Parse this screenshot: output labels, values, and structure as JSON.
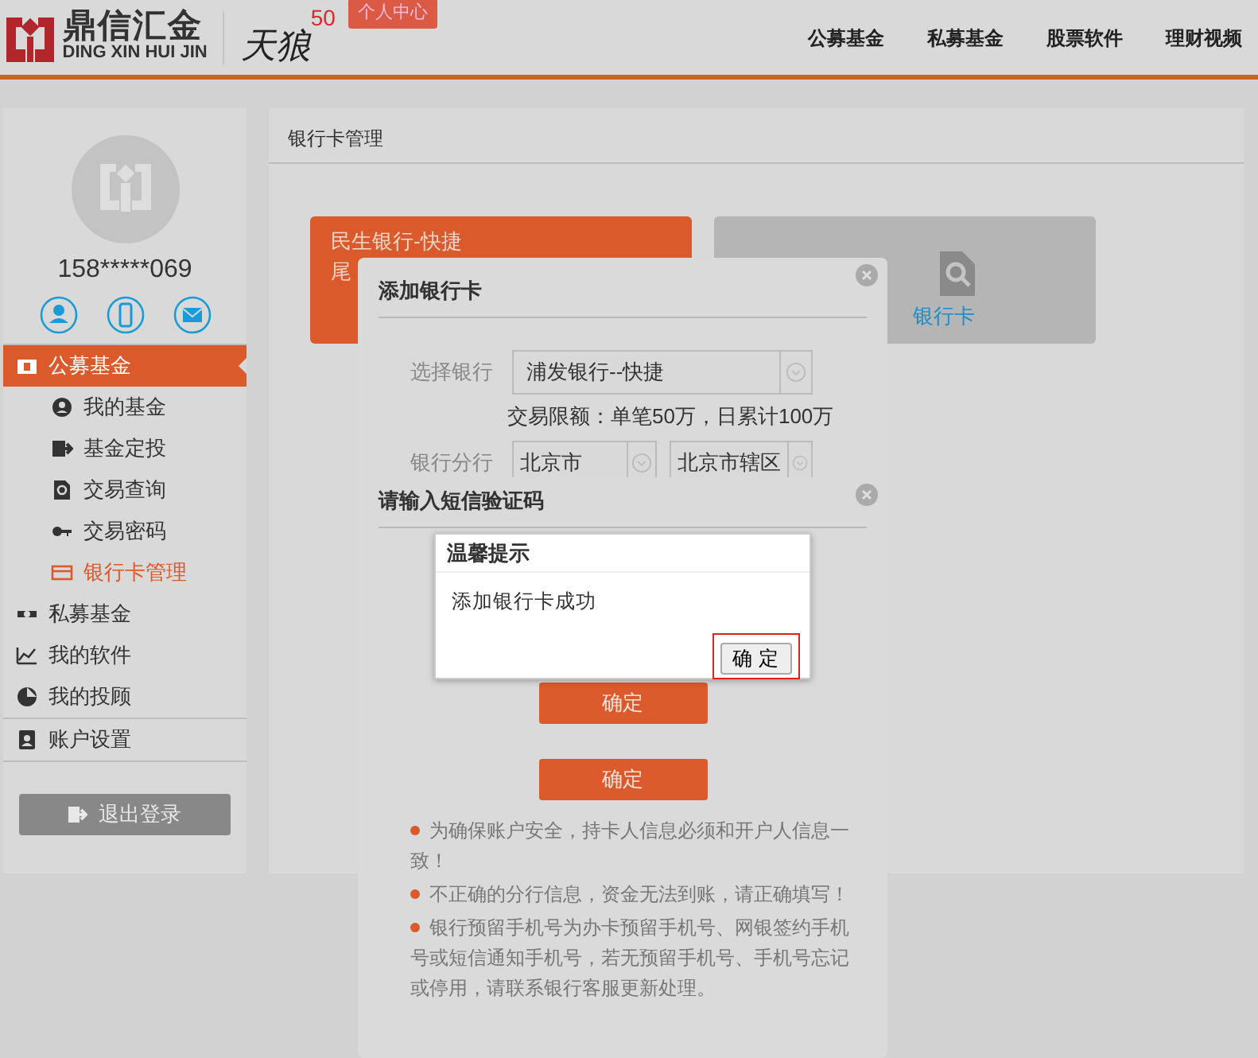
{
  "header": {
    "logo_title": "鼎信汇金",
    "logo_subtitle": "DING XIN HUI JIN",
    "brand_mark": "天狼",
    "brand_number": "50",
    "user_center": "个人中心",
    "nav": [
      {
        "label": "公募基金"
      },
      {
        "label": "私募基金"
      },
      {
        "label": "股票软件"
      },
      {
        "label": "理财视频"
      }
    ]
  },
  "sidebar": {
    "phone": "158*****069",
    "menu": [
      {
        "label": "公募基金",
        "selected": true,
        "children": [
          {
            "label": "我的基金",
            "selected": false
          },
          {
            "label": "基金定投",
            "selected": false
          },
          {
            "label": "交易查询",
            "selected": false
          },
          {
            "label": "交易密码",
            "selected": false
          },
          {
            "label": "银行卡管理",
            "selected": true
          }
        ]
      },
      {
        "label": "私募基金",
        "selected": false
      },
      {
        "label": "我的软件",
        "selected": false
      },
      {
        "label": "我的投顾",
        "selected": false
      },
      {
        "label": "账户设置",
        "selected": false
      }
    ],
    "logout": "退出登录"
  },
  "main": {
    "title": "银行卡管理",
    "cards": [
      {
        "kind": "bank",
        "lines": [
          "民生银行-快捷",
          "尾"
        ]
      },
      {
        "kind": "add",
        "label": "银行卡"
      }
    ]
  },
  "add_card_dialog": {
    "title": "添加银行卡",
    "bank_label": "选择银行",
    "bank_value": "浦发银行--快捷",
    "limit": "交易限额：单笔50万，日累计100万",
    "branch_label": "银行分行",
    "branch_values": [
      "北京市",
      "北京市辖区"
    ]
  },
  "sms_dialog": {
    "title": "请输入短信验证码",
    "buttons": [
      "确定",
      "确定"
    ],
    "notes": [
      "为确保账户安全，持卡人信息必须和开户人信息一致！",
      "不正确的分行信息，资金无法到账，请正确填写！",
      "银行预留手机号为办卡预留手机号、网银签约手机号或短信通知手机号，若无预留手机号、手机号忘记或停用，请联系银行客服更新处理。"
    ]
  },
  "alert": {
    "title": "温馨提示",
    "message": "添加银行卡成功",
    "button": "确 定"
  }
}
